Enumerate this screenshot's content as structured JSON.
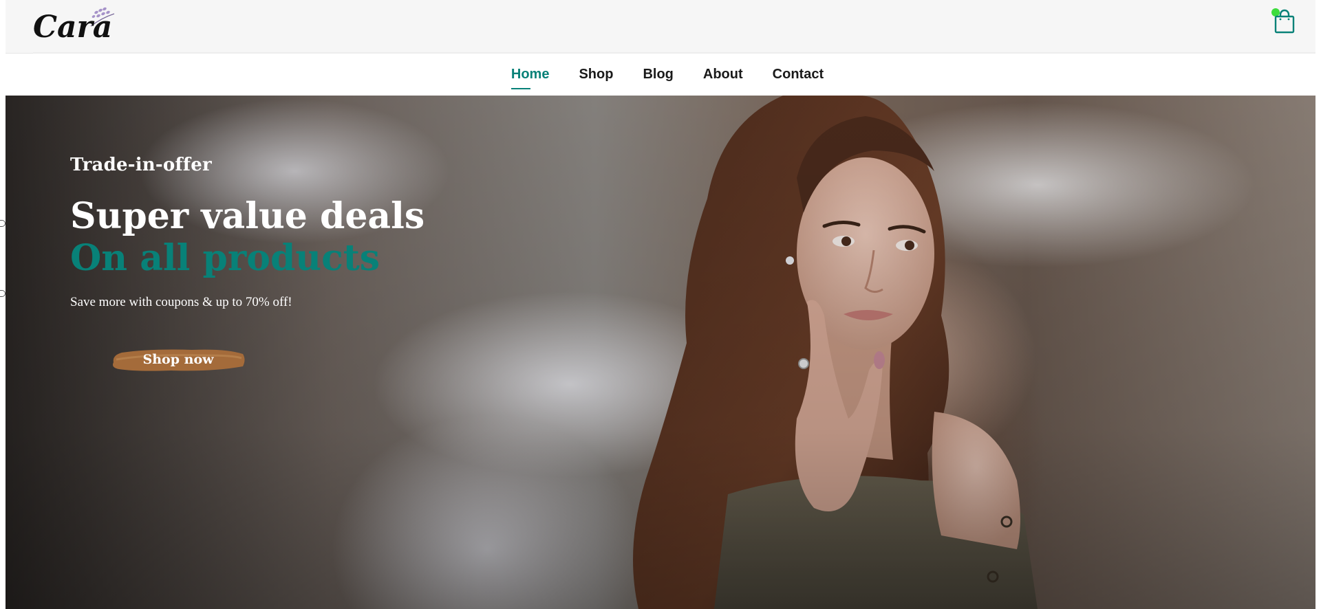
{
  "header": {
    "logo_text": "Cara",
    "cart_icon": "shopping-bag-icon",
    "status_dot_color": "#3ddc3d"
  },
  "nav": {
    "items": [
      {
        "label": "Home",
        "active": true
      },
      {
        "label": "Shop",
        "active": false
      },
      {
        "label": "Blog",
        "active": false
      },
      {
        "label": "About",
        "active": false
      },
      {
        "label": "Contact",
        "active": false
      }
    ]
  },
  "hero": {
    "subtitle": "Trade-in-offer",
    "headline": "Super value deals",
    "headline_accent": "On all products",
    "description": "Save more with coupons & up to 70% off!",
    "button_label": "Shop now"
  },
  "colors": {
    "accent": "#088178",
    "button_brush": "#a46b3a"
  }
}
